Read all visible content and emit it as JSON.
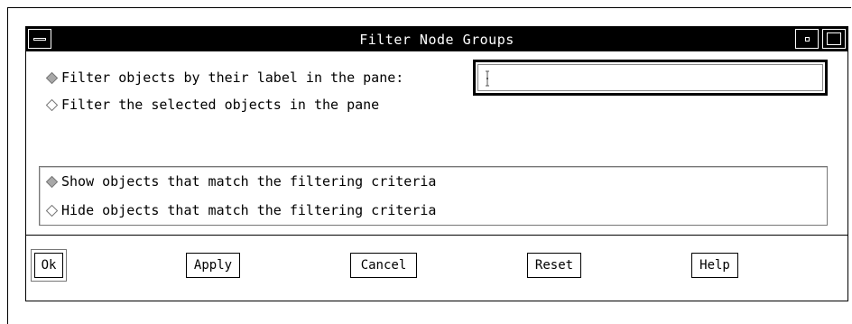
{
  "window": {
    "title": "Filter Node Groups"
  },
  "filter_mode": {
    "options": [
      {
        "label": "Filter objects by their label in the pane:",
        "selected": true
      },
      {
        "label": "Filter the selected objects in the pane",
        "selected": false
      }
    ],
    "label_field": {
      "value": "",
      "placeholder": ""
    }
  },
  "visibility": {
    "options": [
      {
        "label": "Show objects that match the filtering criteria",
        "selected": true
      },
      {
        "label": "Hide objects that match the filtering criteria",
        "selected": false
      }
    ]
  },
  "buttons": {
    "ok": "Ok",
    "apply": "Apply",
    "cancel": "Cancel",
    "reset": "Reset",
    "help": "Help"
  },
  "icons": {
    "window_menu": "window-menu-icon",
    "minimize": "minimize-icon",
    "maximize": "maximize-icon",
    "radio_selected": "diamond-filled-icon",
    "radio_unselected": "diamond-outline-icon",
    "text_cursor": "ibeam-cursor-icon"
  },
  "colors": {
    "titlebar_bg": "#000000",
    "titlebar_fg": "#ffffff",
    "radio_selected_fill": "#a8a8a8",
    "window_bg": "#ffffff"
  }
}
